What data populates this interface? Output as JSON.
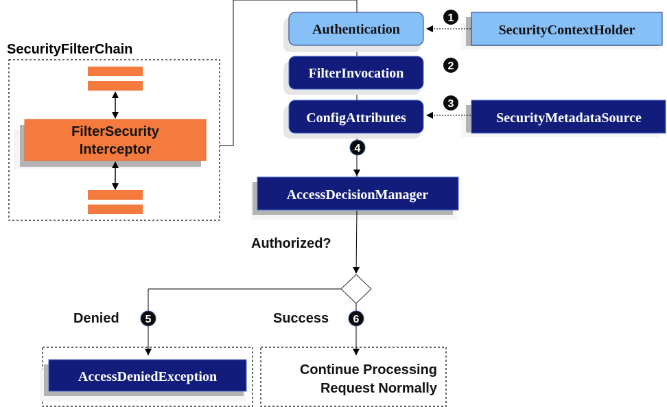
{
  "colors": {
    "orange": "#f47a3e",
    "light_blue": "#87bff7",
    "dark_blue": "#121c7a",
    "shadow": "#b3b3b3",
    "line": "#000000",
    "badge": "#0a0a0a"
  },
  "security_filter_chain": {
    "title": "SecurityFilterChain",
    "interceptor_line1": "FilterSecurity",
    "interceptor_line2": "Interceptor"
  },
  "nodes": {
    "authentication": "Authentication",
    "filter_invocation": "FilterInvocation",
    "config_attributes": "ConfigAttributes",
    "security_context_holder": "SecurityContextHolder",
    "security_metadata_source": "SecurityMetadataSource",
    "access_decision_manager": "AccessDecisionManager",
    "access_denied_exception": "AccessDeniedException",
    "continue_line1": "Continue Processing",
    "continue_line2": "Request Normally"
  },
  "labels": {
    "authorized": "Authorized?",
    "denied": "Denied",
    "success": "Success"
  },
  "badges": [
    "1",
    "2",
    "3",
    "4",
    "5",
    "6"
  ]
}
